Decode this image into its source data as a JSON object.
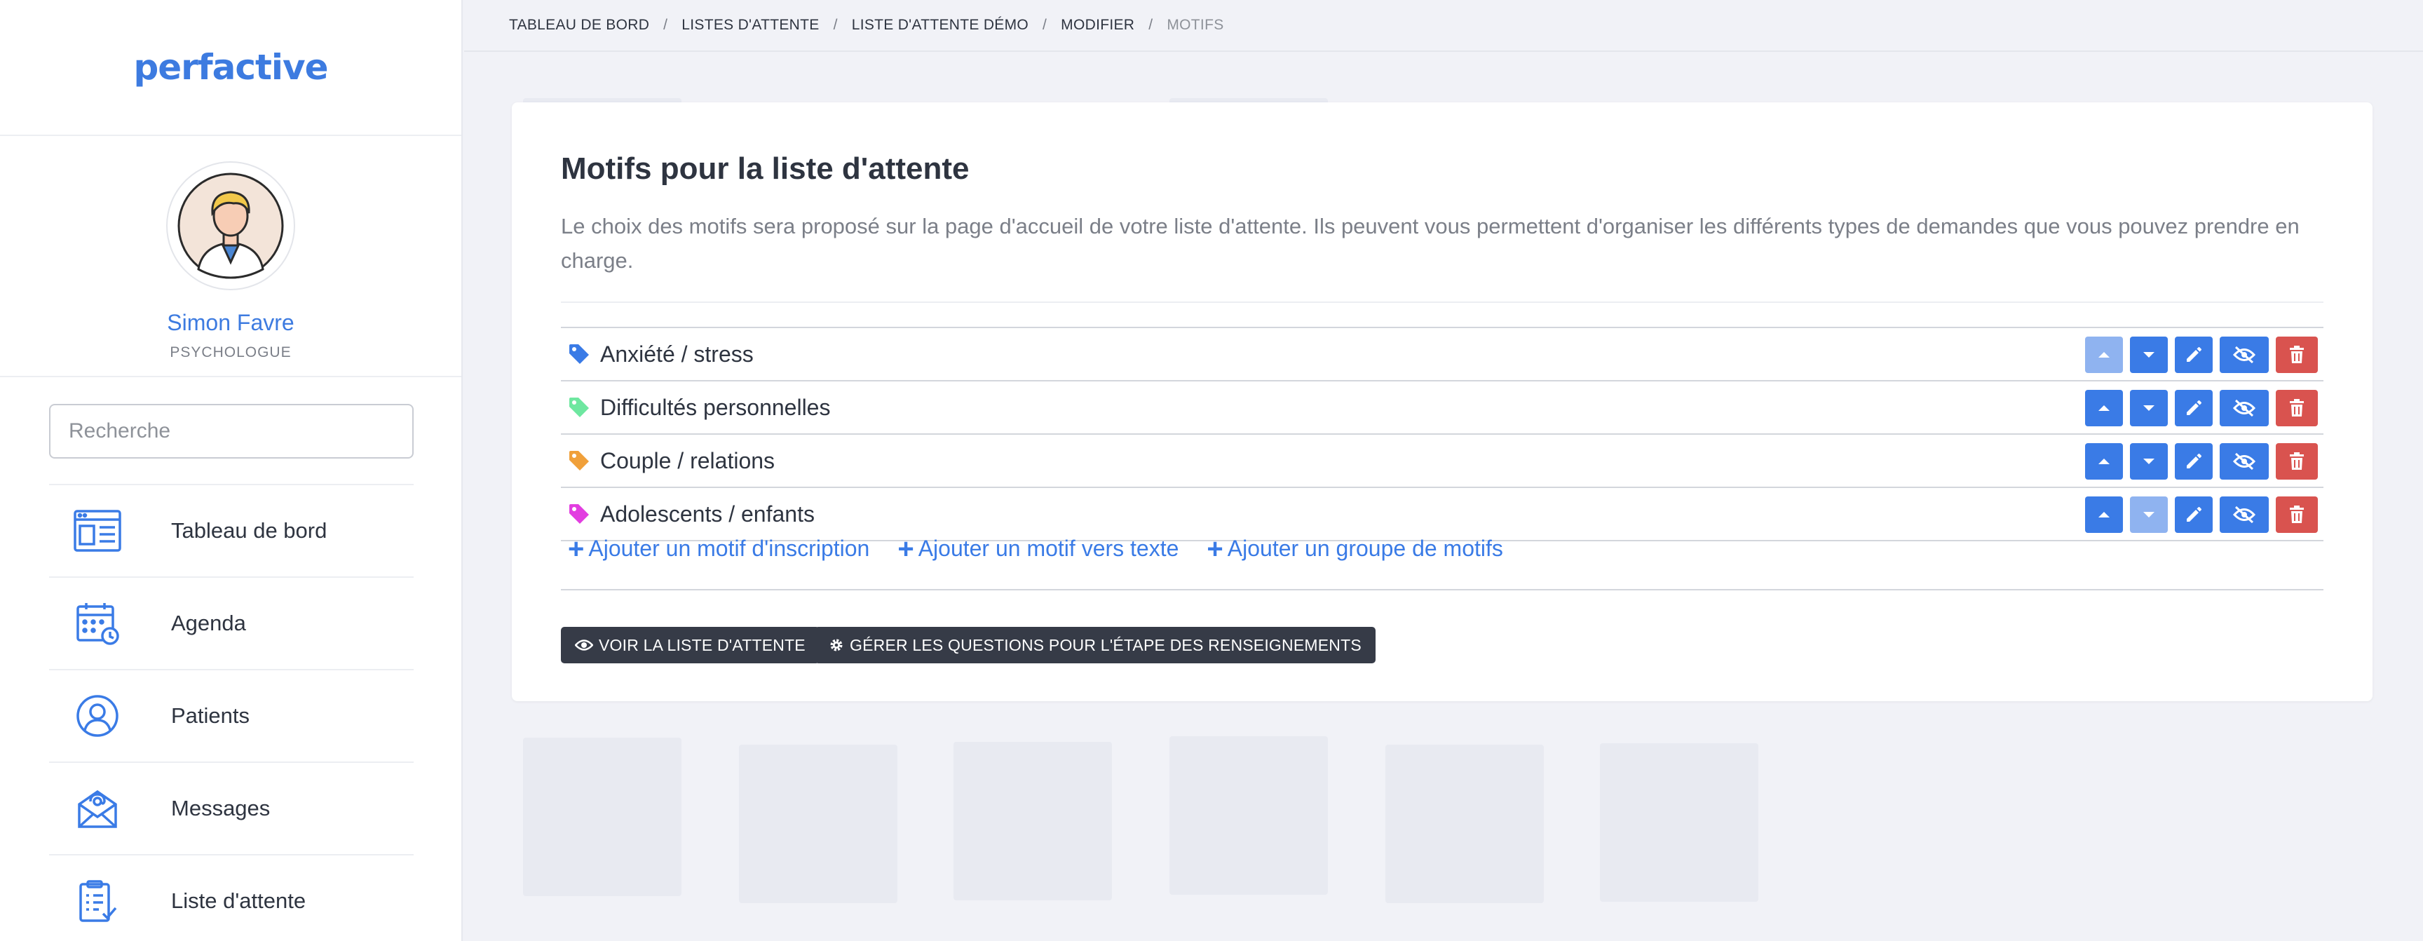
{
  "brand": {
    "logo_text": "perfactive",
    "accent": "#3d7be0"
  },
  "profile": {
    "name": "Simon Favre",
    "role": "PSYCHOLOGUE"
  },
  "search": {
    "placeholder": "Recherche"
  },
  "nav": {
    "items": [
      {
        "label": "Tableau de bord",
        "icon": "dashboard-icon"
      },
      {
        "label": "Agenda",
        "icon": "calendar-icon"
      },
      {
        "label": "Patients",
        "icon": "user-icon"
      },
      {
        "label": "Messages",
        "icon": "mail-icon"
      },
      {
        "label": "Liste d'attente",
        "icon": "clipboard-icon"
      }
    ]
  },
  "breadcrumb": {
    "items": [
      "TABLEAU DE BORD",
      "LISTES D'ATTENTE",
      "LISTE D'ATTENTE DÉMO",
      "MODIFIER"
    ],
    "current": "MOTIFS",
    "separator": "/"
  },
  "card": {
    "title": "Motifs pour la liste d'attente",
    "description": "Le choix des motifs sera proposé sur la page d'accueil de votre liste d'attente. Ils peuvent vous permettent d'organiser les différents types de demandes que vous pouvez prendre en charge."
  },
  "motifs": [
    {
      "label": "Anxiété / stress",
      "tag_color": "#3a7be6",
      "up_disabled": true,
      "down_disabled": false
    },
    {
      "label": "Difficultés personnelles",
      "tag_color": "#6ee7a0",
      "up_disabled": false,
      "down_disabled": false
    },
    {
      "label": "Couple / relations",
      "tag_color": "#f0a03a",
      "up_disabled": false,
      "down_disabled": false
    },
    {
      "label": "Adolescents / enfants",
      "tag_color": "#e23ee0",
      "up_disabled": false,
      "down_disabled": true
    }
  ],
  "add_links": {
    "inscription": "Ajouter un motif d'inscription",
    "texte": "Ajouter un motif vers texte",
    "groupe": "Ajouter un groupe de motifs"
  },
  "buttons": {
    "view_list": "VOIR LA LISTE D'ATTENTE",
    "manage_questions": "GÉRER LES QUESTIONS POUR L'ÉTAPE DES RENSEIGNEMENTS"
  },
  "colors": {
    "primary": "#3a7be6",
    "primary_disabled": "#8fb3f0",
    "danger": "#d9534f",
    "dark_button": "#363b47"
  }
}
